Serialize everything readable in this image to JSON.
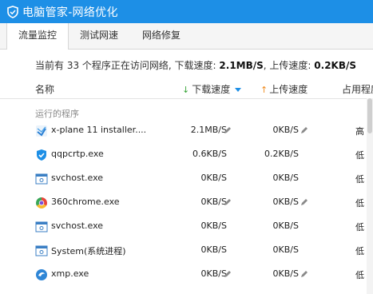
{
  "window": {
    "title": "电脑管家-网络优化"
  },
  "tabs": [
    {
      "label": "流量监控",
      "active": true
    },
    {
      "label": "测试网速",
      "active": false
    },
    {
      "label": "网络修复",
      "active": false
    }
  ],
  "summary": {
    "prefix": "当前有 33 个程序正在访问网络, 下载速度:",
    "download": "2.1MB/S",
    "mid": ", 上传速度:",
    "upload": "0.2KB/S"
  },
  "columns": {
    "name": "名称",
    "download": "下载速度",
    "upload": "上传速度",
    "usage": "占用程度"
  },
  "group": {
    "label": "运行的程序"
  },
  "rows": [
    {
      "name": "x-plane 11 installer....",
      "download": "2.1MB/S",
      "upload": "0KB/S",
      "usage": "高",
      "icon": "xplane-installer-icon"
    },
    {
      "name": "qqpcrtp.exe",
      "download": "0.6KB/S",
      "upload": "0.2KB/S",
      "usage": "低",
      "icon": "qq-pc-manager-icon"
    },
    {
      "name": "svchost.exe",
      "download": "0KB/S",
      "upload": "0KB/S",
      "usage": "低",
      "icon": "system-window-icon"
    },
    {
      "name": "360chrome.exe",
      "download": "0KB/S",
      "upload": "0KB/S",
      "usage": "低",
      "icon": "360chrome-icon"
    },
    {
      "name": "svchost.exe",
      "download": "0KB/S",
      "upload": "0KB/S",
      "usage": "低",
      "icon": "system-window-icon"
    },
    {
      "name": "System(系统进程)",
      "download": "0KB/S",
      "upload": "0KB/S",
      "usage": "低",
      "icon": "system-window-icon"
    },
    {
      "name": "xmp.exe",
      "download": "0KB/S",
      "upload": "0KB/S",
      "usage": "低",
      "icon": "xmp-player-icon"
    }
  ],
  "colors": {
    "titlebar": "#1d8fe6",
    "accent": "#1d8fe6",
    "download_arrow": "#3aa63a",
    "upload_arrow": "#f08a1c"
  }
}
